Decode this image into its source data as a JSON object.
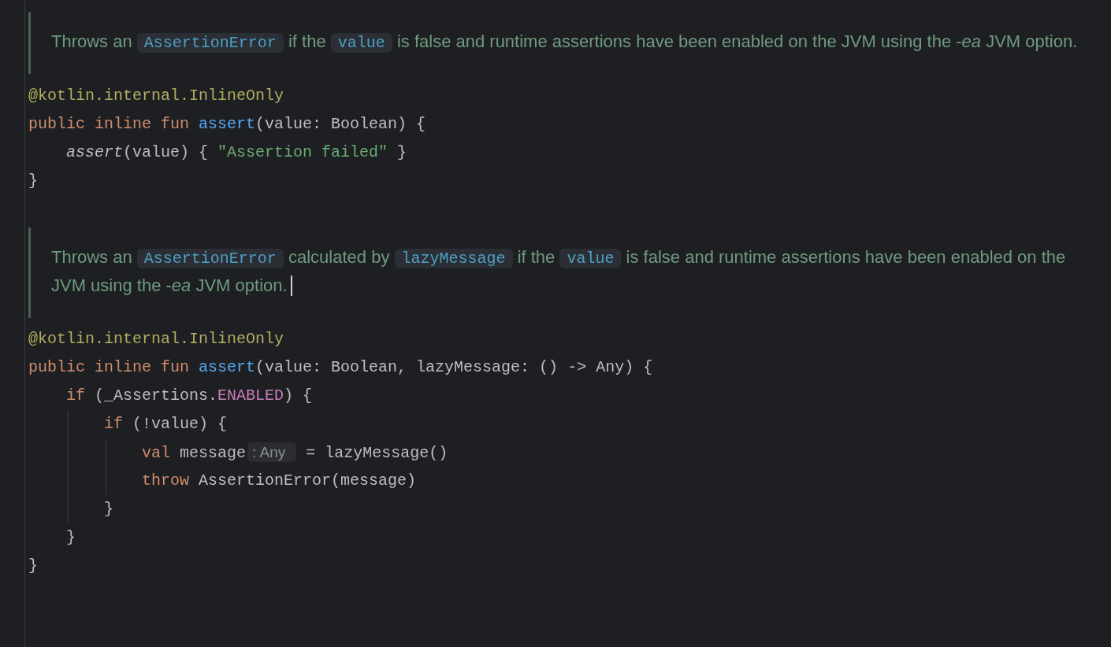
{
  "editor": {
    "blocks": [
      {
        "kind": "doc",
        "caret": false,
        "segments": [
          {
            "kind": "text",
            "text": "Throws an "
          },
          {
            "kind": "code",
            "text": "AssertionError"
          },
          {
            "kind": "text",
            "text": " if the "
          },
          {
            "kind": "code",
            "text": "value"
          },
          {
            "kind": "text",
            "text": " is false and runtime assertions have been enabled on the JVM using the -*ea* JVM option."
          }
        ]
      },
      {
        "kind": "code",
        "lines": [
          {
            "tokens": [
              {
                "kind": "annotation",
                "text": "@kotlin.internal.InlineOnly"
              }
            ]
          },
          {
            "tokens": [
              {
                "kind": "keyword",
                "text": "public inline fun "
              },
              {
                "kind": "function",
                "text": "assert"
              },
              {
                "kind": "plain",
                "text": "(value: Boolean) {"
              }
            ],
            "children": [
              {
                "tokens": [
                  {
                    "kind": "call",
                    "text": "assert"
                  },
                  {
                    "kind": "plain",
                    "text": "(value) { "
                  },
                  {
                    "kind": "string",
                    "text": "\"Assertion failed\""
                  },
                  {
                    "kind": "plain",
                    "text": " }"
                  }
                ]
              }
            ]
          },
          {
            "tokens": [
              {
                "kind": "plain",
                "text": "}"
              }
            ]
          }
        ]
      },
      {
        "kind": "doc",
        "caret": true,
        "segments": [
          {
            "kind": "text",
            "text": "Throws an "
          },
          {
            "kind": "code",
            "text": "AssertionError"
          },
          {
            "kind": "text",
            "text": " calculated by "
          },
          {
            "kind": "code",
            "text": "lazyMessage"
          },
          {
            "kind": "text",
            "text": " if the "
          },
          {
            "kind": "code",
            "text": "value"
          },
          {
            "kind": "text",
            "text": " is false and runtime assertions have been enabled on the JVM using the -*ea* JVM option."
          }
        ]
      },
      {
        "kind": "code",
        "lines": [
          {
            "tokens": [
              {
                "kind": "annotation",
                "text": "@kotlin.internal.InlineOnly"
              }
            ]
          },
          {
            "tokens": [
              {
                "kind": "keyword",
                "text": "public inline fun "
              },
              {
                "kind": "function",
                "text": "assert"
              },
              {
                "kind": "plain",
                "text": "(value: Boolean, lazyMessage: () -> Any) {"
              }
            ],
            "children": [
              {
                "tokens": [
                  {
                    "kind": "keyword",
                    "text": "if "
                  },
                  {
                    "kind": "plain",
                    "text": "(_Assertions."
                  },
                  {
                    "kind": "constant",
                    "text": "ENABLED"
                  },
                  {
                    "kind": "plain",
                    "text": ") {"
                  }
                ],
                "children": [
                  {
                    "tokens": [
                      {
                        "kind": "keyword",
                        "text": "if "
                      },
                      {
                        "kind": "plain",
                        "text": "(!value) {"
                      }
                    ],
                    "children": [
                      {
                        "tokens": [
                          {
                            "kind": "keyword",
                            "text": "val "
                          },
                          {
                            "kind": "plain",
                            "text": "message"
                          },
                          {
                            "kind": "hint",
                            "text": ": Any"
                          },
                          {
                            "kind": "plain",
                            "text": " = lazyMessage()"
                          }
                        ]
                      },
                      {
                        "tokens": [
                          {
                            "kind": "keyword",
                            "text": "throw "
                          },
                          {
                            "kind": "plain",
                            "text": "AssertionError(message)"
                          }
                        ]
                      }
                    ]
                  },
                  {
                    "tokens": [
                      {
                        "kind": "plain",
                        "text": "}"
                      }
                    ]
                  }
                ]
              },
              {
                "tokens": [
                  {
                    "kind": "plain",
                    "text": "}"
                  }
                ]
              }
            ]
          },
          {
            "tokens": [
              {
                "kind": "plain",
                "text": "}"
              }
            ]
          }
        ]
      }
    ]
  }
}
